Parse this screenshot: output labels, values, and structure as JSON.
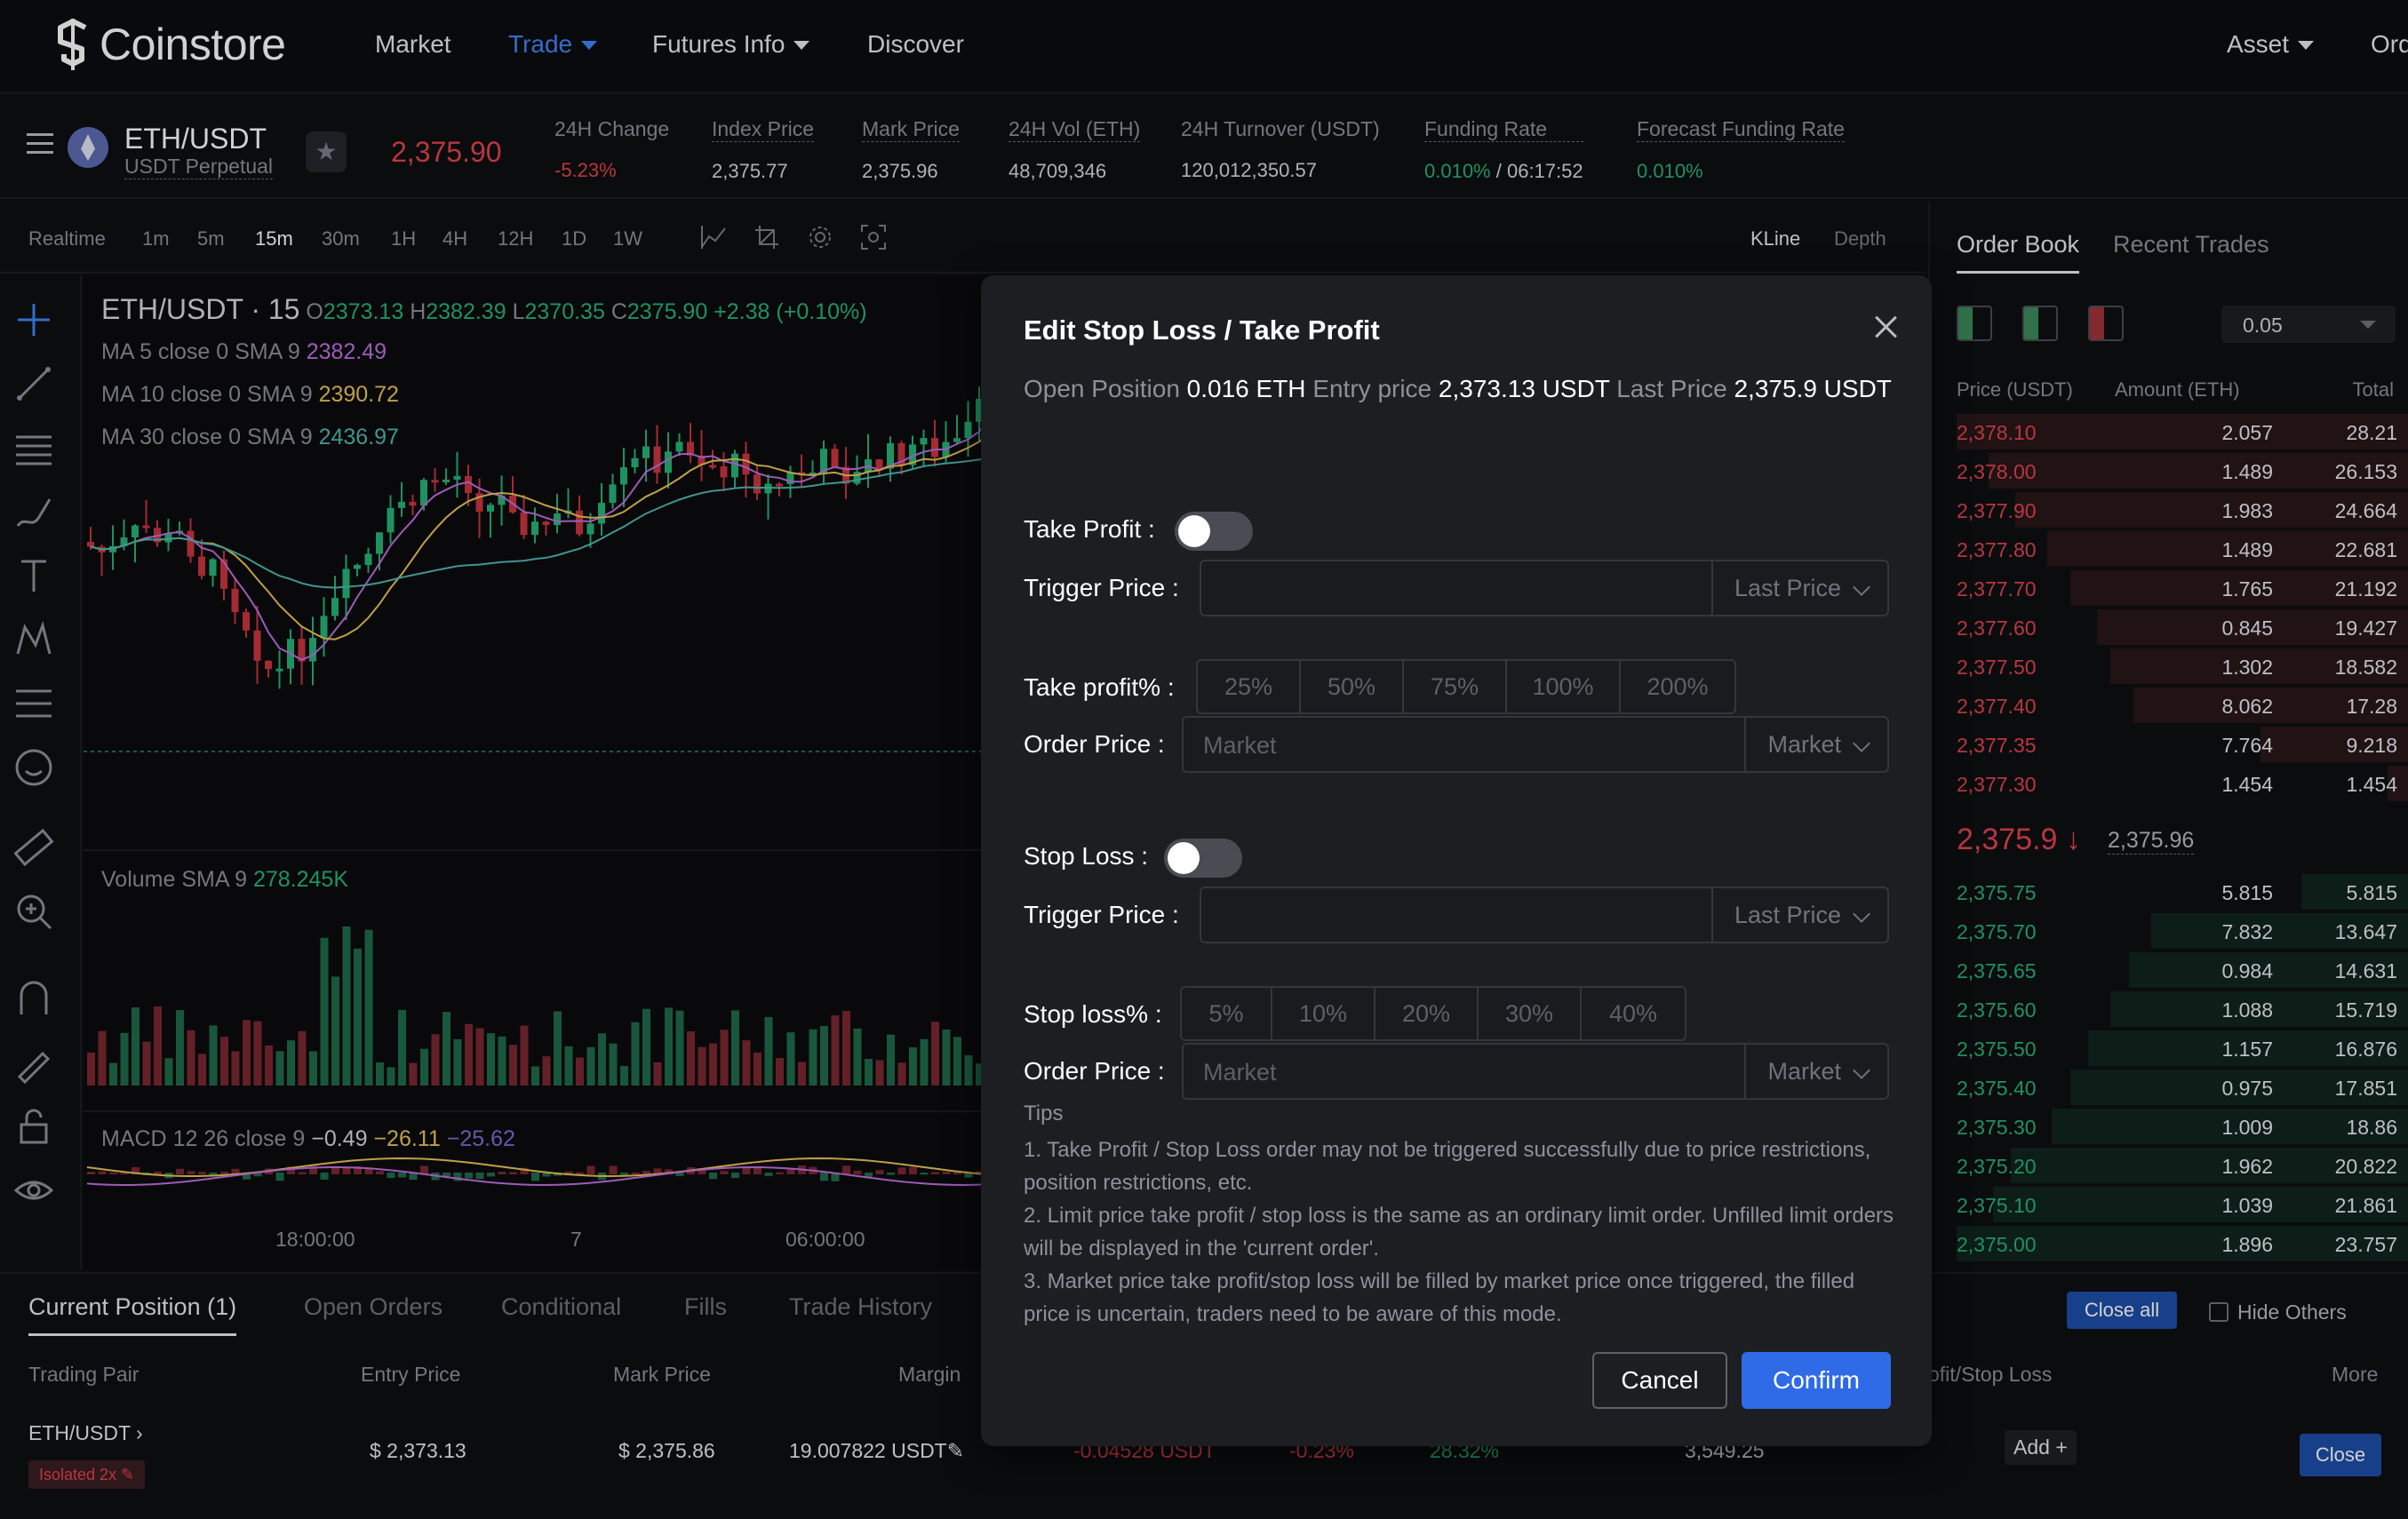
{
  "nav": {
    "brand": "Coinstore",
    "items": [
      {
        "label": "Market",
        "caret": false
      },
      {
        "label": "Trade",
        "caret": true,
        "active": true
      },
      {
        "label": "Futures Info",
        "caret": true
      },
      {
        "label": "Discover",
        "caret": false
      }
    ],
    "right": [
      {
        "label": "Asset",
        "caret": true
      },
      {
        "label": "Ord"
      }
    ]
  },
  "ticker": {
    "pair": "ETH/USDT",
    "contract": "USDT Perpetual",
    "last_price": "2,375.90",
    "stats": [
      {
        "label": "24H Change",
        "value": "-5.23%"
      },
      {
        "label": "Index Price",
        "value": "2,375.77"
      },
      {
        "label": "Mark Price",
        "value": "2,375.96"
      },
      {
        "label": "24H Vol (ETH)",
        "value": "48,709,346"
      },
      {
        "label": "24H Turnover (USDT)",
        "value": "120,012,350.57"
      },
      {
        "label": "Funding Rate",
        "value_rate": "0.010%",
        "value_sep": " / ",
        "value_timer": "06:17:52"
      },
      {
        "label": "Forecast Funding Rate",
        "value": "0.010%"
      }
    ]
  },
  "chart_toolbar": {
    "timeframes": [
      "Realtime",
      "1m",
      "5m",
      "15m",
      "30m",
      "1H",
      "4H",
      "12H",
      "1D",
      "1W"
    ],
    "selected": "15m",
    "views": [
      "KLine",
      "Depth"
    ]
  },
  "chart": {
    "title": "ETH/USDT · 15",
    "ohlc": {
      "o_label": "O",
      "o": "2373.13",
      "h_label": "H",
      "h": "2382.39",
      "l_label": "L",
      "l": "2370.35",
      "c_label": "C",
      "c": "2375.90",
      "change": "+2.38 (+0.10%)"
    },
    "ma": [
      {
        "label": "MA",
        "params": "5 close 0 SMA 9",
        "value": "2382.49",
        "color": "#c070e0"
      },
      {
        "label": "MA",
        "params": "10 close 0 SMA 9",
        "value": "2390.72",
        "color": "#e8c45a"
      },
      {
        "label": "MA",
        "params": "30 close 0 SMA 9",
        "value": "2436.97",
        "color": "#4fb6b0"
      }
    ],
    "volume": {
      "label": "Volume",
      "params": "SMA 9",
      "value": "278.245K"
    },
    "macd": {
      "label": "MACD",
      "params": "12 26 close 9",
      "v1": "−0.49",
      "v2": "−26.11",
      "v3": "−25.62"
    },
    "time_labels": [
      "18:00:00",
      "7",
      "06:00:00"
    ]
  },
  "orderbook": {
    "tabs": [
      "Order Book",
      "Recent Trades"
    ],
    "precision": "0.05",
    "headers": [
      "Price (USDT)",
      "Amount (ETH)",
      "Total"
    ],
    "asks": [
      {
        "price": "2,378.10",
        "amount": "2.057",
        "total": "28.21",
        "depth": 1.0
      },
      {
        "price": "2,378.00",
        "amount": "1.489",
        "total": "26.153",
        "depth": 0.93
      },
      {
        "price": "2,377.90",
        "amount": "1.983",
        "total": "24.664",
        "depth": 0.87
      },
      {
        "price": "2,377.80",
        "amount": "1.489",
        "total": "22.681",
        "depth": 0.8
      },
      {
        "price": "2,377.70",
        "amount": "1.765",
        "total": "21.192",
        "depth": 0.75
      },
      {
        "price": "2,377.60",
        "amount": "0.845",
        "total": "19.427",
        "depth": 0.69
      },
      {
        "price": "2,377.50",
        "amount": "1.302",
        "total": "18.582",
        "depth": 0.66
      },
      {
        "price": "2,377.40",
        "amount": "8.062",
        "total": "17.28",
        "depth": 0.61
      },
      {
        "price": "2,377.35",
        "amount": "7.764",
        "total": "9.218",
        "depth": 0.33
      },
      {
        "price": "2,377.30",
        "amount": "1.454",
        "total": "1.454",
        "depth": 0.05
      }
    ],
    "mid_price": "2,375.9",
    "mid_arrow": "↓",
    "mark_price": "2,375.96",
    "bids": [
      {
        "price": "2,375.75",
        "amount": "5.815",
        "total": "5.815",
        "depth": 0.24
      },
      {
        "price": "2,375.70",
        "amount": "7.832",
        "total": "13.647",
        "depth": 0.57
      },
      {
        "price": "2,375.65",
        "amount": "0.984",
        "total": "14.631",
        "depth": 0.62
      },
      {
        "price": "2,375.60",
        "amount": "1.088",
        "total": "15.719",
        "depth": 0.66
      },
      {
        "price": "2,375.50",
        "amount": "1.157",
        "total": "16.876",
        "depth": 0.71
      },
      {
        "price": "2,375.40",
        "amount": "0.975",
        "total": "17.851",
        "depth": 0.75
      },
      {
        "price": "2,375.30",
        "amount": "1.009",
        "total": "18.86",
        "depth": 0.79
      },
      {
        "price": "2,375.20",
        "amount": "1.962",
        "total": "20.822",
        "depth": 0.88
      },
      {
        "price": "2,375.10",
        "amount": "1.039",
        "total": "21.861",
        "depth": 0.92
      },
      {
        "price": "2,375.00",
        "amount": "1.896",
        "total": "23.757",
        "depth": 1.0
      }
    ]
  },
  "positions": {
    "tabs": [
      "Current Position (1)",
      "Open Orders",
      "Conditional",
      "Fills",
      "Trade History"
    ],
    "close_all": "Close all",
    "hide_others": "Hide Others",
    "headers": {
      "pair": "Trading Pair",
      "entry": "Entry Price",
      "mark": "Mark Price",
      "margin": "Margin",
      "tpsl": "ofit/Stop Loss",
      "more": "More"
    },
    "row": {
      "pair": "ETH/USDT",
      "mode": "Isolated 2x",
      "entry": "$ 2,373.13",
      "mark": "$ 2,375.86",
      "margin": "19.007822 USDT",
      "pnl": "-0.04528 USDT",
      "pnl_pct": "-0.23%",
      "margin_ratio": "28.32%",
      "liq": "3,549.25",
      "add": "Add +",
      "close": "Close"
    }
  },
  "modal": {
    "title": "Edit Stop Loss / Take Profit",
    "info": {
      "open_label": "Open Position",
      "open_value": "0.016 ETH",
      "entry_label": "Entry price",
      "entry_value": "2,373.13 USDT",
      "last_label": "Last Price",
      "last_value": "2,375.9 USDT"
    },
    "take_profit": {
      "label": "Take Profit :",
      "enabled": false,
      "trigger_label": "Trigger Price :",
      "trigger_value": "",
      "trigger_type": "Last Price",
      "pct_label": "Take profit% :",
      "pcts": [
        "25%",
        "50%",
        "75%",
        "100%",
        "200%"
      ],
      "order_label": "Order Price :",
      "order_placeholder": "Market",
      "order_type": "Market"
    },
    "stop_loss": {
      "label": "Stop Loss :",
      "enabled": false,
      "trigger_label": "Trigger Price :",
      "trigger_value": "",
      "trigger_type": "Last Price",
      "pct_label": "Stop loss% :",
      "pcts": [
        "5%",
        "10%",
        "20%",
        "30%",
        "40%"
      ],
      "order_label": "Order Price :",
      "order_placeholder": "Market",
      "order_type": "Market"
    },
    "tips_title": "Tips",
    "tips": [
      "1. Take Profit / Stop Loss order may not be triggered successfully due to price restrictions, position restrictions, etc.",
      "2. Limit price take profit / stop loss is the same as an ordinary limit order. Unfilled limit orders will be displayed in the 'current order'.",
      "3. Market price take profit/stop loss will be filled by market price once triggered, the filled price is uncertain, traders need to be aware of this mode."
    ],
    "cancel": "Cancel",
    "confirm": "Confirm"
  }
}
